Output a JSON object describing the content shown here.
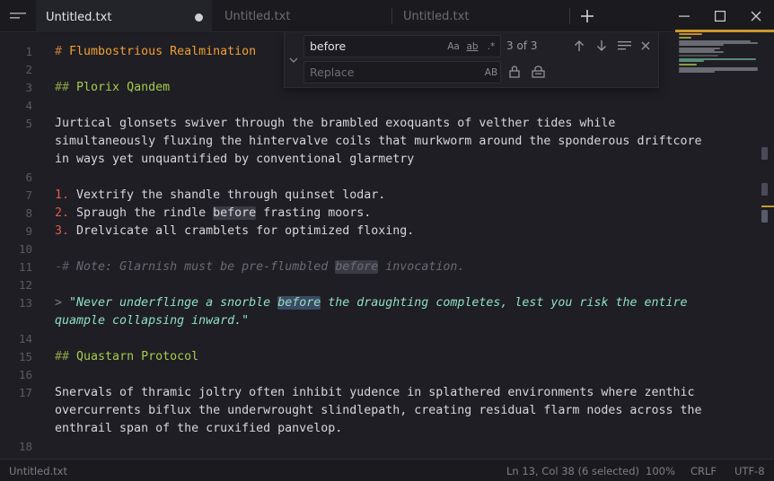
{
  "tabs": [
    {
      "label": "Untitled.txt",
      "active": true,
      "modified": true
    },
    {
      "label": "Untitled.txt",
      "active": false
    },
    {
      "label": "Untitled.txt",
      "active": false
    }
  ],
  "find": {
    "query": "before",
    "match_case_label": "Aa",
    "whole_word_label": "ab",
    "regex_label": ".*",
    "match_count": "3 of 3",
    "replace_placeholder": "Replace",
    "preserve_case_label": "AB"
  },
  "editor": {
    "line_numbers": [
      "1",
      "2",
      "3",
      "4",
      "5",
      "",
      "",
      "6",
      "7",
      "8",
      "9",
      "10",
      "11",
      "12",
      "13",
      "",
      "14",
      "15",
      "16",
      "17",
      "",
      "",
      "18"
    ],
    "l1_hash": "# ",
    "l1_text": "Flumbostrious Realmination",
    "l3_hash": "## ",
    "l3_text": "Plorix Qandem",
    "l5a": "Jurtical glonsets swiver through the brambled exoquants of velther tides while",
    "l5b": "simultaneously fluxing the hintervalve coils that murkworm around the sponderous driftcore",
    "l5c": "in ways yet unquantified by conventional glarmetry",
    "l7_num": "1.",
    "l7_text": " Vextrify the shandle through quinset lodar.",
    "l8_num": "2.",
    "l8_pre": " Spraugh the rindle ",
    "l8_match": "before",
    "l8_post": " frasting moors.",
    "l9_num": "3.",
    "l9_text": " Drelvicate all cramblets for optimized floxing.",
    "l11_hash": "-# ",
    "l11_pre": "Note: Glarnish must be pre-flumbled ",
    "l11_match": "before",
    "l11_post": " invocation.",
    "l13_mark": "> ",
    "l13_pre": "\"Never underflinge a snorble ",
    "l13_match": "before",
    "l13_post": " the draughting completes, lest you risk the entire",
    "l13b": "quample collapsing inward.\"",
    "l15_hash": "## ",
    "l15_text": "Quastarn Protocol",
    "l17a": "Snervals of thramic joltry often inhibit yudence in splathered environments where zenthic",
    "l17b": "overcurrents biflux the underwrought slindlepath, creating residual flarm nodes across the",
    "l17c": "enthrail span of the cruxified panvelop."
  },
  "status": {
    "filename": "Untitled.txt",
    "position": "Ln 13, Col 38 (6 selected)",
    "zoom": "100%",
    "line_ending": "CRLF",
    "encoding": "UTF-8"
  },
  "colors": {
    "accent": "#c99a2e",
    "heading1": "#f0a030",
    "heading2": "#a8cc4a",
    "list_number": "#e8564a",
    "quote": "#8fe0c0"
  }
}
